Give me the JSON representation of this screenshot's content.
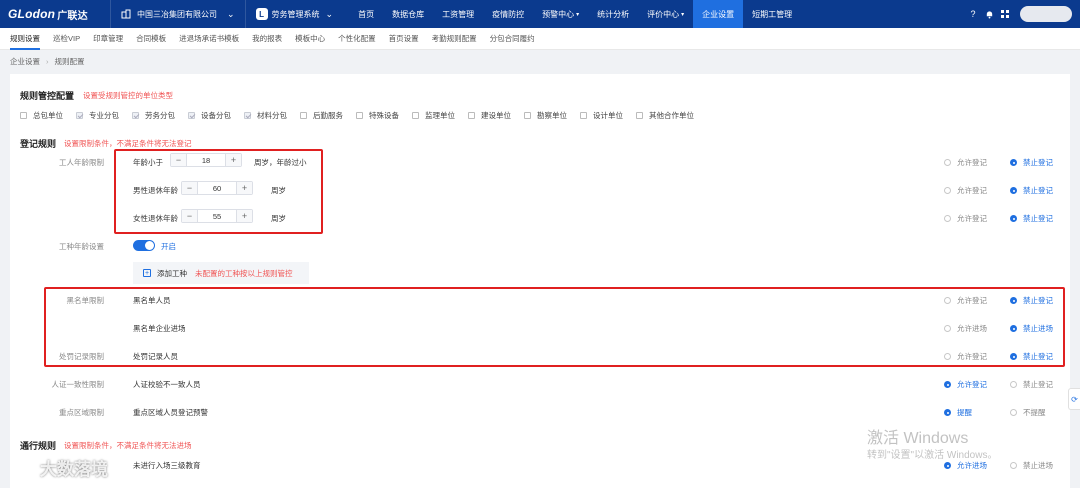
{
  "topbar": {
    "logo": "GLodon",
    "logo_cn": "广联达",
    "org": "中国三冶集团有限公司",
    "system": "劳务管理系统",
    "nav": [
      {
        "label": "首页",
        "caret": false
      },
      {
        "label": "数据仓库",
        "caret": false
      },
      {
        "label": "工资管理",
        "caret": false
      },
      {
        "label": "疫情防控",
        "caret": false
      },
      {
        "label": "预警中心",
        "caret": true
      },
      {
        "label": "统计分析",
        "caret": false
      },
      {
        "label": "评价中心",
        "caret": true
      },
      {
        "label": "企业设置",
        "caret": false,
        "active": true
      },
      {
        "label": "短期工管理",
        "caret": false
      }
    ]
  },
  "subtabs": [
    "规则设置",
    "巡检VIP",
    "印章管理",
    "合同模板",
    "进退场承诺书模板",
    "我的报表",
    "模板中心",
    "个性化配置",
    "首页设置",
    "考勤规则配置",
    "分包合同履约"
  ],
  "breadcrumb": [
    "企业设置",
    "规则配置"
  ],
  "control": {
    "title": "规则管控配置",
    "note": "设置受规则管控的单位类型",
    "types": [
      {
        "label": "总包单位",
        "checked": false
      },
      {
        "label": "专业分包",
        "checked": true
      },
      {
        "label": "劳务分包",
        "checked": true
      },
      {
        "label": "设备分包",
        "checked": true
      },
      {
        "label": "材料分包",
        "checked": true
      },
      {
        "label": "后勤服务",
        "checked": false
      },
      {
        "label": "特殊设备",
        "checked": false
      },
      {
        "label": "监理单位",
        "checked": false
      },
      {
        "label": "建设单位",
        "checked": false
      },
      {
        "label": "勘察单位",
        "checked": false
      },
      {
        "label": "设计单位",
        "checked": false
      },
      {
        "label": "其他合作单位",
        "checked": false
      }
    ]
  },
  "register": {
    "title": "登记规则",
    "note": "设置限制条件，不满足条件将无法登记",
    "age_label": "工人年龄限制",
    "age_min": {
      "prefix": "年龄小于",
      "value": "18",
      "suffix": "周岁，年龄过小"
    },
    "male": {
      "prefix": "男性退休年龄",
      "value": "60",
      "suffix": "周岁"
    },
    "female": {
      "prefix": "女性退休年龄",
      "value": "55",
      "suffix": "周岁"
    },
    "allow": "允许登记",
    "forbid": "禁止登记",
    "trade_label": "工种年龄设置",
    "trade_toggle": "开启",
    "add_trade": "添加工种",
    "add_trade_note": "未配置的工种按以上规则管控",
    "blacklist_label": "黑名单限制",
    "blacklist_person": "黑名单人员",
    "blacklist_company": "黑名单企业进场",
    "allow_enter": "允许进场",
    "forbid_enter": "禁止进场",
    "punish_label": "处罚记录限制",
    "punish_person": "处罚记录人员",
    "idcard_label": "人证一致性限制",
    "idcard_text": "人证校验不一致人员",
    "area_label": "重点区域限制",
    "area_text": "重点区域人员登记预警",
    "remind": "提醒",
    "noremind": "不提醒"
  },
  "pass": {
    "title": "通行规则",
    "note": "设置限制条件，不满足条件将无法进场",
    "edu_text": "未进行入场三级教育",
    "allow_enter": "允许进场",
    "forbid_enter": "禁止进场"
  },
  "watermark": {
    "line1": "激活 Windows",
    "line2": "转到\"设置\"以激活 Windows。",
    "brand": "大数落境"
  }
}
